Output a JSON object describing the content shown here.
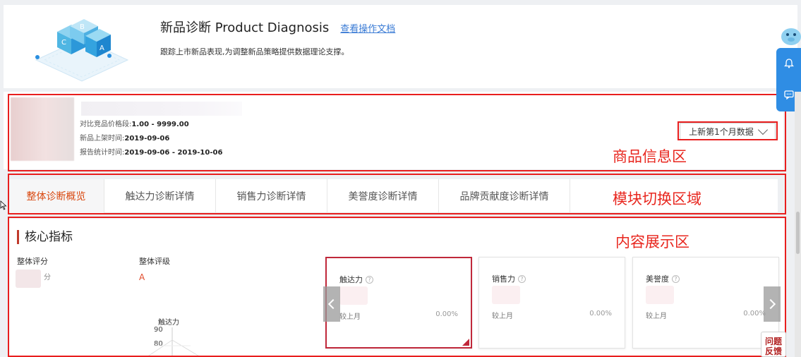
{
  "header": {
    "title": "新品诊断 Product Diagnosis",
    "doc_link": "查看操作文档",
    "subtitle": "跟踪上市新品表现,为调整新品策略提供数据理论支撑。",
    "logo_letters": [
      "B",
      "C",
      "A"
    ]
  },
  "product": {
    "price_band_label": "对比竞品价格段:",
    "price_band_value": "1.00 - 9999.00",
    "listed_label": "新品上架时间:",
    "listed_value": "2019-09-06",
    "period_label": "报告统计时间:",
    "period_value": "2019-09-06 - 2019-10-06",
    "month_select": "上新第1个月数据"
  },
  "tabs": [
    {
      "label": "整体诊断概览",
      "active": true
    },
    {
      "label": "触达力诊断详情"
    },
    {
      "label": "销售力诊断详情"
    },
    {
      "label": "美誉度诊断详情"
    },
    {
      "label": "品牌贡献度诊断详情"
    }
  ],
  "content": {
    "section_title": "核心指标",
    "overall_score_label": "整体评分",
    "score_unit": "分",
    "overall_grade_label": "整体评级",
    "grade": "A",
    "radar_axis_label": "触达力",
    "radar_ticks": [
      "90",
      "80"
    ],
    "cards": [
      {
        "title": "触达力",
        "mom_label": "较上月",
        "mom_value": "0.00%"
      },
      {
        "title": "销售力",
        "mom_label": "较上月",
        "mom_value": "0.00%"
      },
      {
        "title": "美誉度",
        "mom_label": "较上月",
        "mom_value": "0.00%"
      }
    ]
  },
  "annotations": {
    "product_area": "商品信息区",
    "tab_area": "模块切换区域",
    "content_area": "内容展示区"
  },
  "feedback": "问题反馈",
  "colors": {
    "annotation_red": "#e81e1e",
    "active_tab": "#d9480f",
    "accent_blue": "#2f8de4"
  }
}
